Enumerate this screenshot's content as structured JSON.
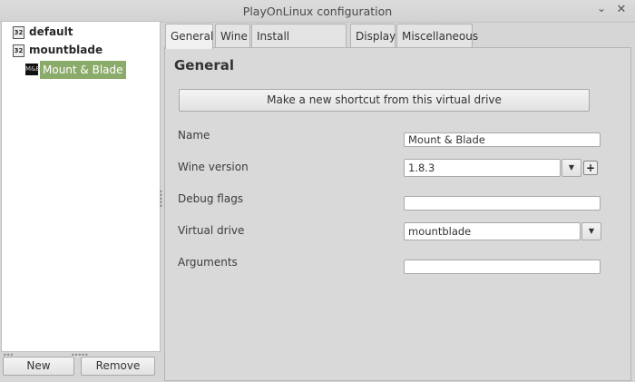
{
  "window": {
    "title": "PlayOnLinux configuration"
  },
  "tree": {
    "items": [
      {
        "label": "default",
        "icon": "wine-32-icon"
      },
      {
        "label": "mountblade",
        "icon": "wine-32-icon"
      }
    ],
    "child": {
      "label": "Mount & Blade",
      "icon": "game-icon",
      "selected": true
    }
  },
  "buttons": {
    "new": "New",
    "remove": "Remove"
  },
  "tabs": [
    {
      "label": "General",
      "active": true
    },
    {
      "label": "Wine"
    },
    {
      "label": "Install components"
    },
    {
      "label": "Display"
    },
    {
      "label": "Miscellaneous"
    }
  ],
  "general": {
    "heading": "General",
    "shortcut_button": "Make a new shortcut from this virtual drive",
    "name_label": "Name",
    "name_value": "Mount & Blade",
    "wine_version_label": "Wine version",
    "wine_version_value": "1.8.3",
    "debug_flags_label": "Debug flags",
    "debug_flags_value": "",
    "virtual_drive_label": "Virtual drive",
    "virtual_drive_value": "mountblade",
    "arguments_label": "Arguments",
    "arguments_value": ""
  }
}
